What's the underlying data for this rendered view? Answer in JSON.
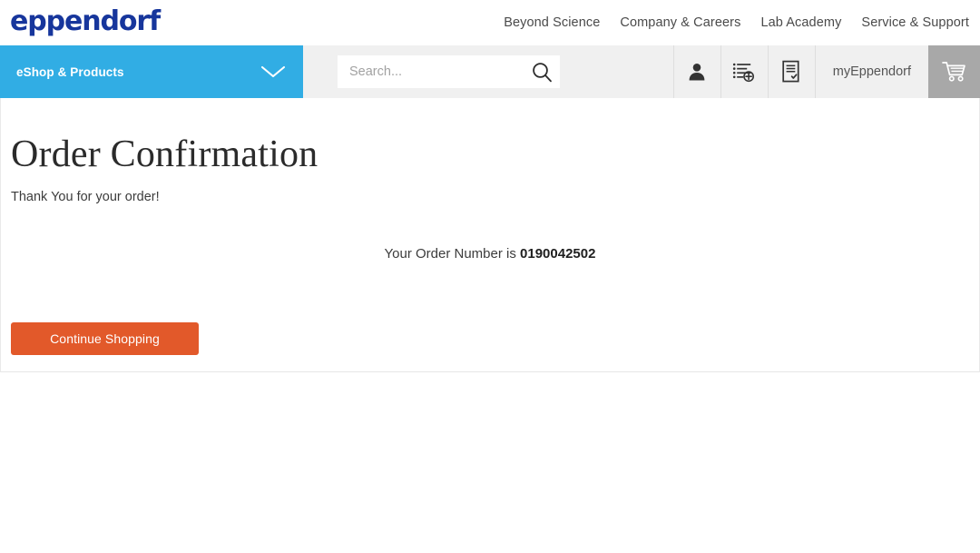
{
  "header": {
    "logo_text": "eppendorf",
    "nav": [
      {
        "label": "Beyond Science"
      },
      {
        "label": "Company & Careers"
      },
      {
        "label": "Lab Academy"
      },
      {
        "label": "Service & Support"
      }
    ]
  },
  "secondary_bar": {
    "eshop_label": "eShop & Products",
    "eshop_chevron_icon": "chevron-down-icon",
    "search": {
      "placeholder": "Search...",
      "value": "",
      "search_icon": "search-icon"
    },
    "icons": [
      {
        "name": "user-account-icon",
        "title": "Account"
      },
      {
        "name": "add-to-list-icon",
        "title": "Quick order list"
      },
      {
        "name": "order-document-icon",
        "title": "Orders"
      }
    ],
    "my_eppendorf_label": "myEppendorf",
    "cart_icon": "shopping-cart-icon"
  },
  "main": {
    "title": "Order Confirmation",
    "thank_you": "Thank You for your order!",
    "order_number_prefix": "Your Order Number is ",
    "order_number": "0190042502",
    "continue_button": "Continue Shopping"
  },
  "colors": {
    "brand_blue": "#17369c",
    "eshop_blue": "#31ade4",
    "accent_orange": "#e2592a",
    "bar_grey": "#f0f0f0",
    "cart_grey": "#a8a8a8"
  }
}
